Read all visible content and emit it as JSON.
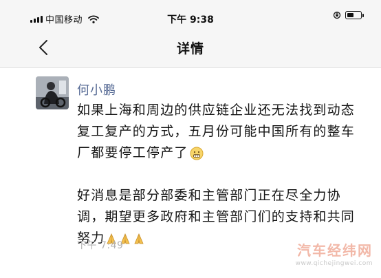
{
  "status_bar": {
    "carrier": "中国移动",
    "time": "下午 9:38"
  },
  "nav": {
    "title": "详情"
  },
  "post": {
    "author": "何小鹏",
    "paragraph_1": "如果上海和周边的供应链企业还无法找到动态复工复产的方式，五月份可能中国所有的整车厂都要停工停产了",
    "paragraph_2": "好消息是部分部委和主管部门正在尽全力协调，期望更多政府和主管部门们的支持和共同努力",
    "time": "下午 7:49"
  },
  "watermark": {
    "main": "汽车经纬网",
    "sub": "www.qichejingwei.com"
  },
  "colors": {
    "author_link": "#576b95",
    "timestamp": "#b2b2b2",
    "bar_background": "#f6f6f6",
    "watermark": "#f2b8a8"
  },
  "icons": [
    "signal-icon",
    "wifi-icon",
    "rotation-lock-icon",
    "battery-icon",
    "back-chevron-icon",
    "grimace-emoji-icon",
    "pray-emoji-icon"
  ]
}
